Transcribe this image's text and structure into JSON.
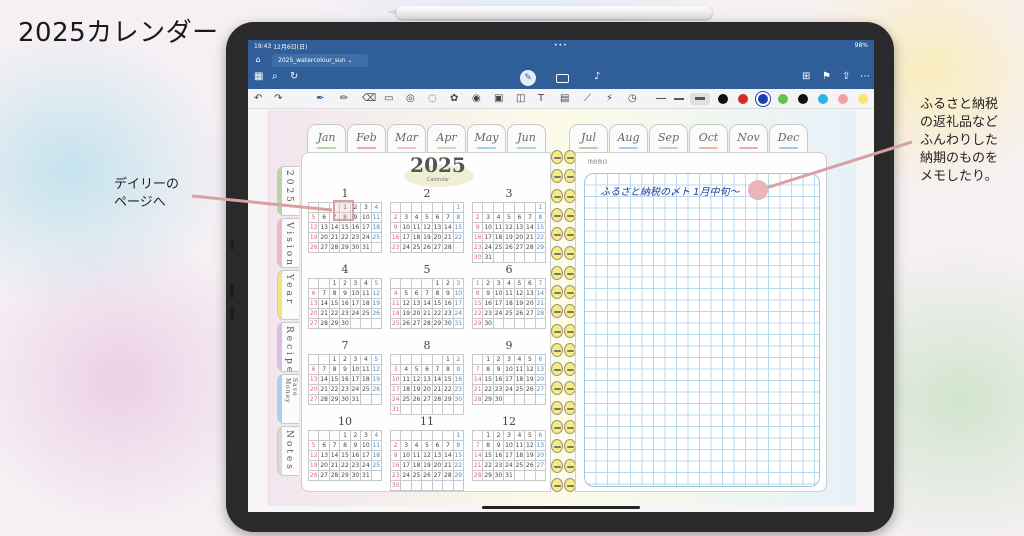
{
  "page_title": "2025カレンダー",
  "device": {
    "status_bar": {
      "time": "19:43",
      "date": "12月6日(日)",
      "dots": "•••",
      "battery": "98%"
    },
    "doc_tab": {
      "title": "2025_watercolour_sun",
      "chevron": "⌄"
    },
    "navbar_icons": [
      "grid-icon",
      "search-icon",
      "share-alt-icon",
      "pen-mode-icon",
      "keyboard-icon",
      "mic-icon",
      "add-page-icon",
      "bookmark-icon",
      "export-icon",
      "more-icon"
    ],
    "toolbar_tools": [
      "undo-icon",
      "redo-icon",
      "fountain-pen-icon",
      "pencil-icon",
      "eraser-icon",
      "highlighter-icon",
      "shape-icon",
      "lasso-icon",
      "elements-icon",
      "sticker-icon",
      "image-icon",
      "camera-icon",
      "text-icon",
      "scan-icon",
      "ruler-icon",
      "laser-icon",
      "timer-icon"
    ],
    "pen_colors": [
      "#111111",
      "#d42b2b",
      "#1e3fb0",
      "#66c24a",
      "#111111",
      "#2fb4e6",
      "#f0a0a6",
      "#f7e86b"
    ]
  },
  "planner": {
    "month_tabs": [
      {
        "label": "Jan",
        "underline": "#b7d4a8"
      },
      {
        "label": "Feb",
        "underline": "#e8a8b8"
      },
      {
        "label": "Mar",
        "underline": "#f2c0c6"
      },
      {
        "label": "Apr",
        "underline": "#d8d8b0"
      },
      {
        "label": "May",
        "underline": "#a8d0e8"
      },
      {
        "label": "Jun",
        "underline": "#a8d8c8"
      },
      {
        "label": "Jul",
        "underline": "#b7d4a8"
      },
      {
        "label": "Aug",
        "underline": "#a8d0e8"
      },
      {
        "label": "Sep",
        "underline": "#d8c0e0"
      },
      {
        "label": "Oct",
        "underline": "#f0b8a8"
      },
      {
        "label": "Nov",
        "underline": "#e8a8b8"
      },
      {
        "label": "Dec",
        "underline": "#a8c8e0"
      }
    ],
    "side_tabs": [
      {
        "label": "2025",
        "color": "#b7d4a8"
      },
      {
        "label": "Vision",
        "color": "#f0b8c4"
      },
      {
        "label": "Year",
        "color": "#f4e27a"
      },
      {
        "label": "Recipe",
        "color": "#d8c0e0"
      },
      {
        "label": "Save Money",
        "color": "#a8d0e8"
      },
      {
        "label": "Notes",
        "color": "#d8d8d8"
      }
    ],
    "calendar": {
      "year": "2025",
      "subtitle": "Calendar",
      "months": [
        {
          "num": "1",
          "start": 3,
          "days": 31
        },
        {
          "num": "2",
          "start": 6,
          "days": 28
        },
        {
          "num": "3",
          "start": 6,
          "days": 31
        },
        {
          "num": "4",
          "start": 2,
          "days": 30
        },
        {
          "num": "5",
          "start": 4,
          "days": 31
        },
        {
          "num": "6",
          "start": 0,
          "days": 30
        },
        {
          "num": "7",
          "start": 2,
          "days": 31
        },
        {
          "num": "8",
          "start": 5,
          "days": 31
        },
        {
          "num": "9",
          "start": 1,
          "days": 30
        },
        {
          "num": "10",
          "start": 3,
          "days": 31
        },
        {
          "num": "11",
          "start": 6,
          "days": 30
        },
        {
          "num": "12",
          "start": 1,
          "days": 31
        }
      ]
    },
    "memo": {
      "label": "memo",
      "handwriting": "ふるさと納税の〆ト 1月中旬〜"
    }
  },
  "annotations": {
    "left": [
      "デイリーの",
      "ページへ"
    ],
    "right": [
      "ふるさと納税",
      "の返礼品など",
      "ふんわりした",
      "納期のものを",
      "メモしたり。"
    ]
  }
}
